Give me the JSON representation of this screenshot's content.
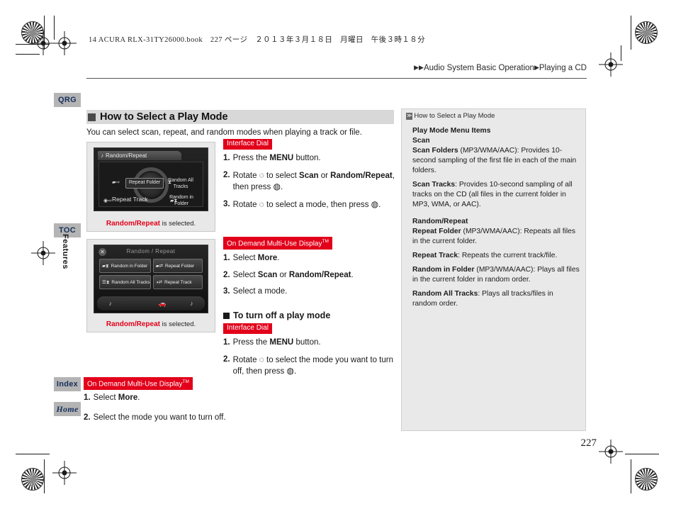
{
  "print": {
    "slug": "14 ACURA RLX-31TY26000.book　227 ページ　２０１３年３月１８日　月曜日　午後３時１８分",
    "page_number": "227"
  },
  "breadcrumb": {
    "arrow1": "▶▶",
    "section": "Audio System Basic Operation",
    "arrow2": "▶",
    "topic": "Playing a CD"
  },
  "side_tabs": {
    "qrg": "QRG",
    "toc": "TOC",
    "features": "Features",
    "index": "Index",
    "home": "Home"
  },
  "main": {
    "heading": "How to Select a Play Mode",
    "intro": "You can select scan, repeat, and random modes when playing a track or file.",
    "figure1": {
      "title": "Random/Repeat",
      "note_icon": "♪",
      "items": {
        "repeat_folder": "Repeat Folder",
        "random_all_tracks": "Random All Tracks",
        "repeat_track": "Repeat Track",
        "random_in_folder": "Random in Folder"
      },
      "caption_bold": "Random/Repeat",
      "caption_rest": " is selected."
    },
    "figure2": {
      "title": "Random / Repeat",
      "close_icon": "✕",
      "buttons": [
        "Random in Folder",
        "Repeat  Folder",
        "Random All Tracks",
        "Repeat  Track"
      ],
      "bottom_icons": [
        "♪",
        "",
        "🚗",
        "♪"
      ],
      "caption_bold": "Random/Repeat",
      "caption_rest": " is selected."
    },
    "proc1": {
      "badge": "Interface Dial",
      "steps": [
        {
          "n": "1.",
          "pre": "Press the ",
          "bold": "MENU",
          "post": " button."
        },
        {
          "n": "2.",
          "pre": "Rotate ",
          "g1": "◌",
          "mid": " to select ",
          "bold": "Scan",
          "mid2": " or ",
          "bold2": "Random/Repeat",
          "post": ", then press ",
          "g2": "◍",
          "end": "."
        },
        {
          "n": "3.",
          "pre": "Rotate ",
          "g1": "◌",
          "mid": " to select a mode, then press ",
          "g2": "◍",
          "end": "."
        }
      ]
    },
    "proc2": {
      "badge": "On Demand Multi-Use Display",
      "badge_tm": "TM",
      "steps": [
        {
          "n": "1.",
          "pre": "Select ",
          "bold": "More",
          "post": "."
        },
        {
          "n": "2.",
          "pre": "Select ",
          "bold": "Scan",
          "mid2": " or ",
          "bold2": "Random/Repeat",
          "post": "."
        },
        {
          "n": "3.",
          "pre": "Select a mode.",
          "bold": "",
          "post": ""
        }
      ]
    },
    "turnoff": {
      "subhead": "To turn off a play mode",
      "badge1": "Interface Dial",
      "steps1": [
        {
          "n": "1.",
          "pre": "Press the ",
          "bold": "MENU",
          "post": " button."
        },
        {
          "n": "2.",
          "pre": "Rotate ",
          "g1": "◌",
          "mid": " to select the mode you want to turn off, then press ",
          "g2": "◍",
          "end": "."
        }
      ],
      "badge2": "On Demand Multi-Use Display",
      "badge2_tm": "TM",
      "steps2": [
        {
          "n": "1.",
          "pre": "Select ",
          "bold": "More",
          "post": "."
        },
        {
          "n": "2.",
          "pre": "Select the mode you want to turn off.",
          "bold": "",
          "post": ""
        }
      ]
    }
  },
  "panel": {
    "header": "How to Select a Play Mode",
    "title": "Play Mode Menu Items",
    "scan_head": "Scan",
    "scan_folders_bold": "Scan Folders",
    "scan_folders_rest": " (MP3/WMA/AAC): Provides 10-second sampling of the first file in each of the main folders.",
    "scan_tracks_bold": "Scan Tracks",
    "scan_tracks_rest": ": Provides 10-second sampling of all tracks on the CD (all files in the current folder in MP3, WMA, or AAC).",
    "rr_head": "Random/Repeat",
    "repeat_folder_bold": "Repeat Folder",
    "repeat_folder_rest": " (MP3/WMA/AAC): Repeats all files in the current folder.",
    "repeat_track_bold": "Repeat Track",
    "repeat_track_rest": ": Repeats the current track/file.",
    "random_in_folder_bold": "Random in Folder",
    "random_in_folder_rest": " (MP3/WMA/AAC): Plays all files in the current folder in random order.",
    "random_all_bold": "Random All Tracks",
    "random_all_rest": ": Plays all tracks/files in random order."
  }
}
